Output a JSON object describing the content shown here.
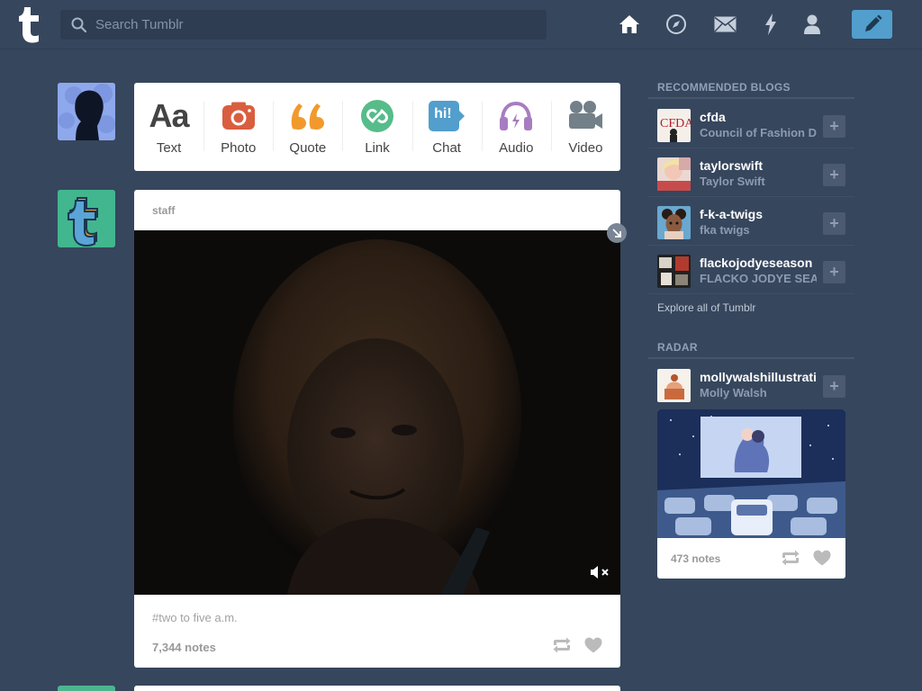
{
  "header": {
    "search_placeholder": "Search Tumblr",
    "logo_letter": "t",
    "nav": [
      "home-icon",
      "explore-icon",
      "messages-icon",
      "activity-icon",
      "account-icon"
    ],
    "compose": "pencil-icon"
  },
  "post_types": [
    {
      "label": "Text",
      "icon": "text-icon",
      "color": "#444444",
      "glyph": "Aa"
    },
    {
      "label": "Photo",
      "icon": "camera-icon",
      "color": "#d95e40"
    },
    {
      "label": "Quote",
      "icon": "quote-icon",
      "color": "#f2992e"
    },
    {
      "label": "Link",
      "icon": "link-icon",
      "color": "#56bc8a"
    },
    {
      "label": "Chat",
      "icon": "chat-icon",
      "color": "#529ecc",
      "glyph": "hi!"
    },
    {
      "label": "Audio",
      "icon": "headphones-icon",
      "color": "#a77dc2"
    },
    {
      "label": "Video",
      "icon": "video-camera-icon",
      "color": "#748089"
    }
  ],
  "post": {
    "author": "staff",
    "tags": "#two to five a.m.",
    "notes": "7,344 notes"
  },
  "sidebar": {
    "recommended_heading": "RECOMMENDED BLOGS",
    "blogs": [
      {
        "name": "cfda",
        "title": "Council of Fashion D"
      },
      {
        "name": "taylorswift",
        "title": "Taylor Swift"
      },
      {
        "name": "f-k-a-twigs",
        "title": "fka twigs"
      },
      {
        "name": "flackojodyeseason",
        "title": "FLACKO JODYE SEA"
      }
    ],
    "explore_link": "Explore all of Tumblr",
    "radar_heading": "RADAR",
    "radar": {
      "name": "mollywalshillustratio",
      "title": "Molly Walsh",
      "notes": "473 notes"
    }
  },
  "colors": {
    "background": "#36465d",
    "compose": "#529ecc"
  }
}
